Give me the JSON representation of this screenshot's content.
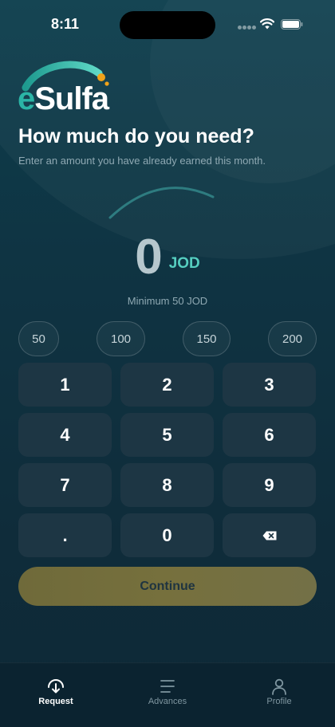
{
  "status_bar": {
    "time": "8:11"
  },
  "logo": {
    "first_letter": "e",
    "rest": "Sulfa"
  },
  "title": "How much do you need?",
  "subtitle": "Enter an amount you have already earned this month.",
  "amount": {
    "value": "0",
    "currency": "JOD"
  },
  "minimum_text": "Minimum 50 JOD",
  "presets": [
    "50",
    "100",
    "150",
    "200"
  ],
  "keypad": {
    "keys": [
      "1",
      "2",
      "3",
      "4",
      "5",
      "6",
      "7",
      "8",
      "9",
      ".",
      "0"
    ],
    "backspace_icon": "backspace-icon"
  },
  "continue_label": "Continue",
  "tab_bar": {
    "items": [
      {
        "label": "Request",
        "icon": "request-icon",
        "active": true
      },
      {
        "label": "Advances",
        "icon": "list-icon",
        "active": false
      },
      {
        "label": "Profile",
        "icon": "profile-icon",
        "active": false
      }
    ]
  },
  "colors": {
    "accent_teal": "#56cec0",
    "continue_button": "#76703d",
    "keypad_key": "#1d3644",
    "background": "#0f2e3b"
  }
}
